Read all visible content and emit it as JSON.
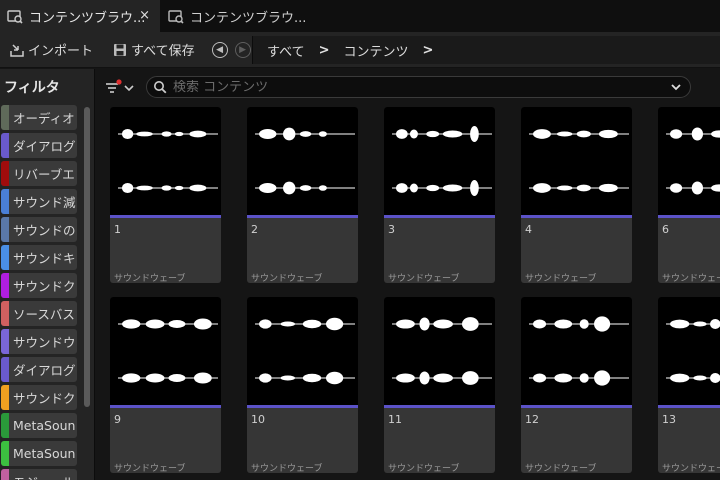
{
  "tabs": [
    {
      "label": "コンテンツブラウ...",
      "active": true,
      "close": "×"
    },
    {
      "label": "コンテンツブラウ...",
      "active": false
    }
  ],
  "toolbar": {
    "import_label": "インポート",
    "save_all_label": "すべて保存"
  },
  "breadcrumb": [
    "すべて",
    "コンテンツ"
  ],
  "sidebar": {
    "title": "フィルタ",
    "filters": [
      {
        "label": "オーディオ",
        "color": "#5f6a5a"
      },
      {
        "label": "ダイアログ",
        "color": "#6a5acd"
      },
      {
        "label": "リバーブエ",
        "color": "#a00c0c"
      },
      {
        "label": "サウンド減",
        "color": "#4a7fd6"
      },
      {
        "label": "サウンドの",
        "color": "#5a78a8"
      },
      {
        "label": "サウンドキ",
        "color": "#4a8fe6"
      },
      {
        "label": "サウンドク",
        "color": "#b01ee0"
      },
      {
        "label": "ソースバス",
        "color": "#d06060"
      },
      {
        "label": "サウンドウ",
        "color": "#7a66d8"
      },
      {
        "label": "ダイアログ",
        "color": "#6a5acd"
      },
      {
        "label": "サウンドク",
        "color": "#f0a020"
      },
      {
        "label": "MetaSoun",
        "color": "#2a9a3a"
      },
      {
        "label": "MetaSoun",
        "color": "#3cc040"
      },
      {
        "label": "モジュール",
        "color": "#c060a0"
      }
    ]
  },
  "search": {
    "placeholder": "検索 コンテンツ"
  },
  "assets": [
    {
      "name": "1",
      "type": "サウンドウェーブ"
    },
    {
      "name": "2",
      "type": "サウンドウェーブ"
    },
    {
      "name": "3",
      "type": "サウンドウェーブ"
    },
    {
      "name": "4",
      "type": "サウンドウェーブ"
    },
    {
      "name": "6",
      "type": "サウンドウェーブ"
    },
    {
      "name": "9",
      "type": "サウンドウェーブ"
    },
    {
      "name": "10",
      "type": "サウンドウェーブ"
    },
    {
      "name": "11",
      "type": "サウンドウェーブ"
    },
    {
      "name": "12",
      "type": "サウンドウェーブ"
    },
    {
      "name": "13",
      "type": "サウンドウェーブ"
    }
  ],
  "colors": {
    "accent_bar": "#5b52c8",
    "unsaved_dot": "#e03030"
  }
}
